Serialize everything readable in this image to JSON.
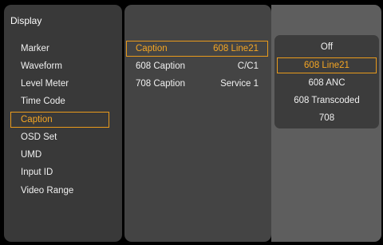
{
  "display_menu": {
    "title": "Display",
    "items": [
      {
        "label": "Marker"
      },
      {
        "label": "Waveform"
      },
      {
        "label": "Level Meter"
      },
      {
        "label": "Time Code"
      },
      {
        "label": "Caption",
        "selected": true
      },
      {
        "label": "OSD Set"
      },
      {
        "label": "UMD"
      },
      {
        "label": "Input ID"
      },
      {
        "label": "Video Range"
      }
    ]
  },
  "caption_menu": {
    "rows": [
      {
        "label": "Caption",
        "value": "608 Line21",
        "selected": true
      },
      {
        "label": "608 Caption",
        "value": "C/C1"
      },
      {
        "label": "708 Caption",
        "value": "Service 1"
      }
    ]
  },
  "caption_options": {
    "options": [
      {
        "label": "Off"
      },
      {
        "label": "608 Line21",
        "selected": true
      },
      {
        "label": "608 ANC"
      },
      {
        "label": "608 Transcoded"
      },
      {
        "label": "708"
      }
    ]
  },
  "colors": {
    "highlight": "#f5a623",
    "highlight_border": "#e89a1c",
    "panel_left": "#393939",
    "panel_mid": "#444444",
    "panel_right": "#5e5e5e"
  }
}
